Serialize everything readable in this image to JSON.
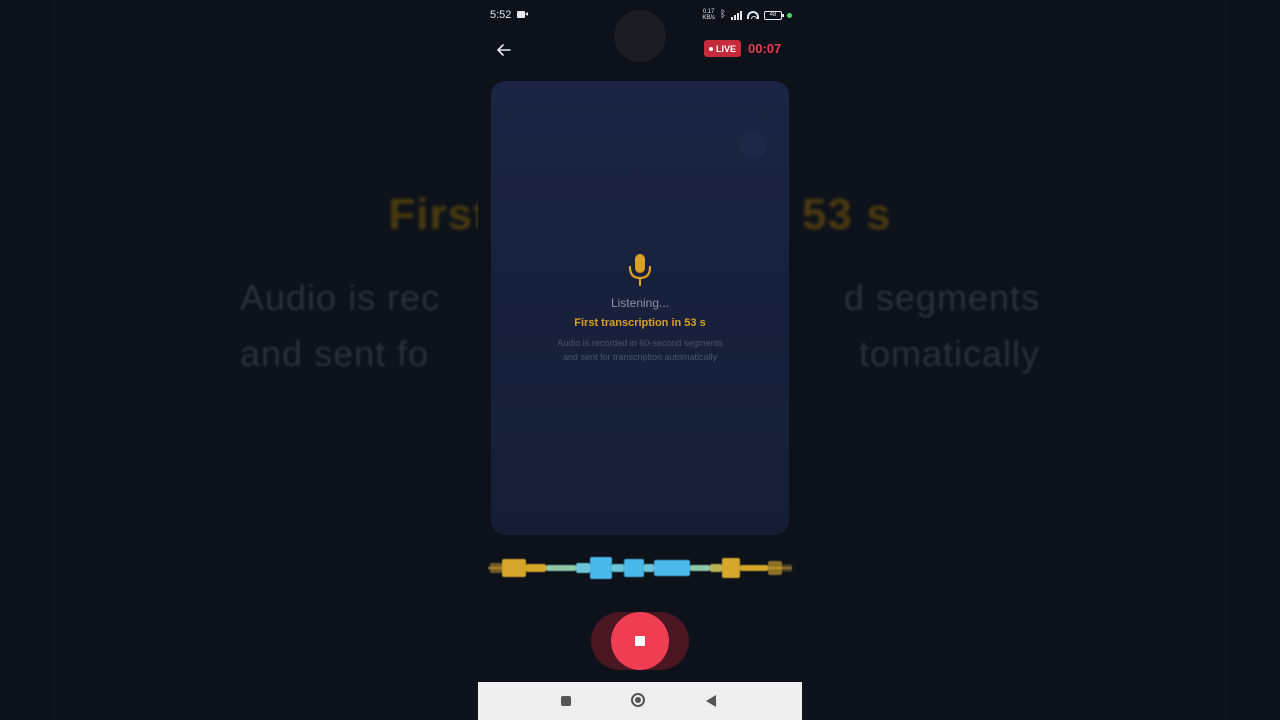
{
  "status_bar": {
    "time": "5:52",
    "net_speed_value": "0.17",
    "net_speed_unit": "KB/s",
    "battery": "48"
  },
  "header": {
    "live_label": "LIVE",
    "timer": "00:07"
  },
  "recording": {
    "listening": "Listening...",
    "first_transcription": "First transcription in 53 s",
    "info_line1": "Audio is recorded in 60-second segments",
    "info_line2": "and sent for transcription automatically"
  },
  "background": {
    "title_left": "First",
    "title_right": "53 s",
    "sub_line1_left": "Audio is rec",
    "sub_line1_right": "d segments",
    "sub_line2_left": "and sent fo",
    "sub_line2_right": "tomatically"
  },
  "colors": {
    "accent": "#d9a126",
    "record_red": "#ef3d52",
    "card_bg": "#1b2442",
    "wave_yellow": "#d4a72a",
    "wave_cyan": "#4ab8e8"
  },
  "icons": {
    "back": "arrow-left-icon",
    "mic": "microphone-icon",
    "stop": "stop-square-icon"
  }
}
